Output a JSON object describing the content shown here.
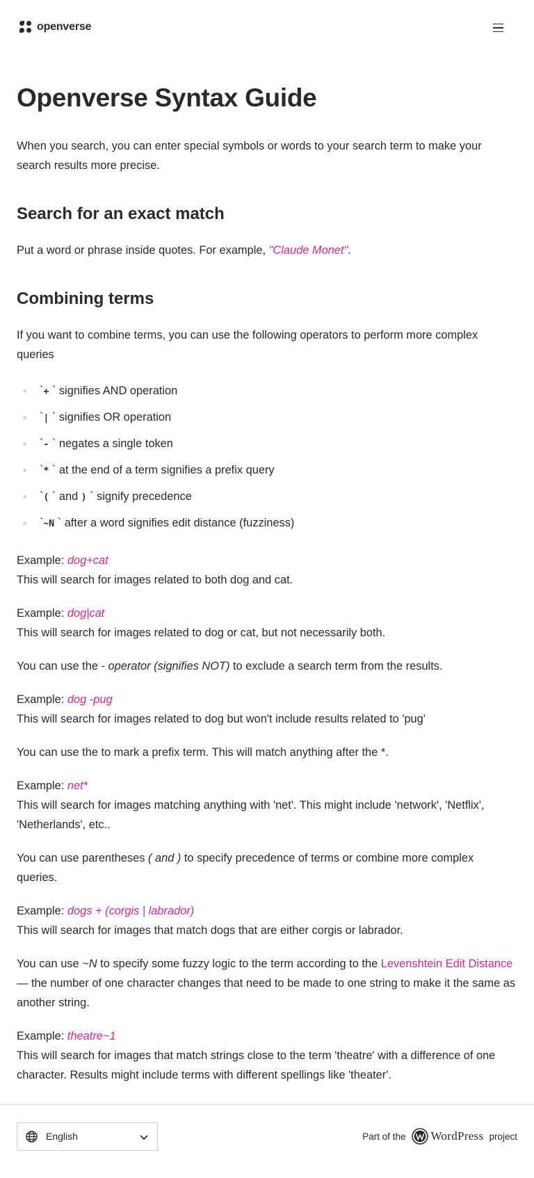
{
  "header": {
    "logo_text": "openverse",
    "menu_icon": "hamburger-menu-icon"
  },
  "page": {
    "title": "Openverse Syntax Guide",
    "intro": "When you search, you can enter special symbols or words to your search term to make your search results more precise.",
    "exact": {
      "heading": "Search for an exact match",
      "text_before": "Put a word or phrase inside quotes. For example, ",
      "example": "\"Claude Monet\"",
      "text_after": "."
    },
    "combining": {
      "heading": "Combining terms",
      "intro": "If you want to combine terms, you can use the following operators to perform more complex queries",
      "operators": [
        {
          "pre": "`",
          "code": "+",
          "post": " ` signifies AND operation"
        },
        {
          "pre": "`",
          "code": "|",
          "post": " ` signifies OR operation"
        },
        {
          "pre": "`",
          "code": "-",
          "post": " ` negates a single token"
        },
        {
          "pre": "`",
          "code": "*",
          "post": " ` at the end of a term signifies a prefix query"
        },
        {
          "pre": "`",
          "code": "(",
          "post": " ` and ",
          "code2": ")",
          "post2": " ` signify precedence"
        },
        {
          "pre": "`",
          "code": "~N",
          "post": " ` after a word signifies edit distance (fuzziness)"
        }
      ]
    },
    "example_label": "Example: ",
    "and_example": {
      "query": "dog+cat",
      "desc": "This will search for images related to both dog and cat."
    },
    "or_example": {
      "query": "dog|cat",
      "desc": "This will search for images related to dog or cat, but not necessarily both."
    },
    "not_text": {
      "before": "You can use the ",
      "em": "- operator (signifies NOT)",
      "after": " to exclude a search term from the results."
    },
    "not_example": {
      "query": "dog -pug",
      "desc": "This will search for images related to dog but won't include results related to 'pug'"
    },
    "prefix_text": "You can use the to mark a prefix term. This will match anything after the *.",
    "prefix_example": {
      "query": "net*",
      "desc": "This will search for images matching anything with 'net'. This might include 'network', 'Netflix', 'Netherlands', etc.."
    },
    "paren_text": {
      "before": "You can use parentheses ",
      "em": "( and )",
      "after": " to specify precedence of terms or combine more complex queries."
    },
    "paren_example": {
      "query": "dogs + (corgis | labrador)",
      "desc": "This will search for images that match dogs that are either corgis or labrador."
    },
    "fuzzy_text": {
      "before": "You can use ",
      "em": "~N",
      "middle": " to specify some fuzzy logic to the term according to the ",
      "link": "Levenshtein Edit Distance",
      "after": " — the number of one character changes that need to be made to one string to make it the same as another string."
    },
    "fuzzy_example": {
      "query": "theatre~1",
      "desc": "This will search for images that match strings close to the term 'theatre' with a difference of one character. Results might include terms with different spellings like 'theater'."
    }
  },
  "footer": {
    "language": "English",
    "part_of": "Part of the",
    "wordpress": "WordPress",
    "project": "project"
  },
  "colors": {
    "accent": "#c52b9b",
    "text": "#30272e"
  }
}
